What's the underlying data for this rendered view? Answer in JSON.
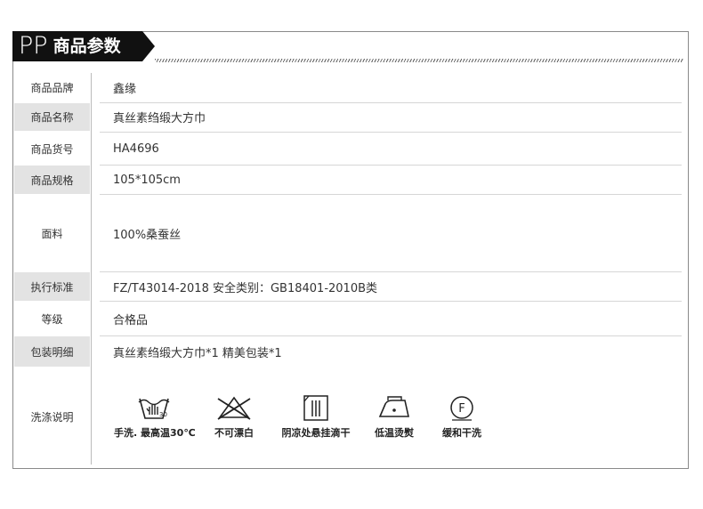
{
  "header": {
    "prefix": "PP",
    "title": "商品参数"
  },
  "params": [
    {
      "label": "商品品牌",
      "value": "鑫缘"
    },
    {
      "label": "商品名称",
      "value": "真丝素绉缎大方巾"
    },
    {
      "label": "商品货号",
      "value": "HA4696"
    },
    {
      "label": "商品规格",
      "value": "105*105cm"
    },
    {
      "label": "面料",
      "value": "100%桑蚕丝"
    },
    {
      "label": "执行标准",
      "value": "FZ/T43014-2018  安全类别：GB18401-2010B类"
    },
    {
      "label": "等级",
      "value": "合格品"
    },
    {
      "label": "包装明细",
      "value": "真丝素绉缎大方巾*1   精美包装*1"
    },
    {
      "label": "洗涤说明"
    }
  ],
  "care": [
    {
      "icon": "hand-wash-icon",
      "label": "手洗. 最高温30℃",
      "temp_symbol": "30"
    },
    {
      "icon": "no-bleach-icon",
      "label": "不可漂白"
    },
    {
      "icon": "line-dry-shade-icon",
      "label": "阴凉处悬挂滴干"
    },
    {
      "icon": "iron-low-icon",
      "label": "低温烫熨"
    },
    {
      "icon": "dry-clean-f-icon",
      "label": "缓和干洗",
      "symbol": "F"
    }
  ]
}
